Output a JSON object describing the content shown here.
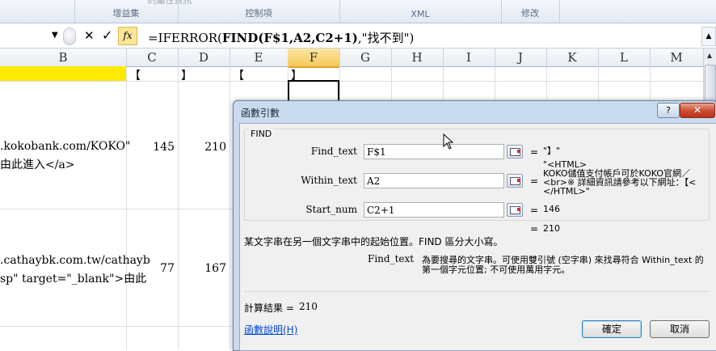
{
  "ribbon": {
    "groups": [
      "增益集",
      "控制項",
      "XML",
      "修改"
    ],
    "faded_top": "的屬性資訊"
  },
  "formula_bar": {
    "cancel_symbol": "✕",
    "enter_symbol": "✓",
    "fx_label": "fx",
    "formula_pre": "=IFERROR(",
    "formula_fn": "FIND(F$1,A2,C2+1)",
    "formula_post": ",\"找不到\")"
  },
  "columns": [
    "B",
    "C",
    "D",
    "E",
    "F",
    "G",
    "H",
    "I",
    "J",
    "K",
    "L",
    "M"
  ],
  "selected_column": "F",
  "grid": {
    "row1": {
      "C": "【",
      "D": "】",
      "E": "【",
      "F": "】"
    },
    "row2": {
      "B_line1": ".kokobank.com/KOKO\"",
      "B_line2": "由此進入</a>",
      "C": "145",
      "D": "210"
    },
    "row3": {
      "B_line1": ".cathaybk.com.tw/cathayb",
      "B_line2": "sp\" target=\"_blank\">由此",
      "C": "77",
      "D": "167"
    }
  },
  "dialog": {
    "title": "函數引數",
    "help_symbol": "?",
    "close_symbol": "✕",
    "function_name": "FIND",
    "args": [
      {
        "label": "Find_text",
        "value": "F$1",
        "result": "\"】\""
      },
      {
        "label": "Within_text",
        "value": "A2",
        "result": "\"<HTML>\nKOKO儲值支付帳戶可於KOKO官網／\n<br>※ 詳細資訊請參考以下網址：【<\n</HTML>\""
      },
      {
        "label": "Start_num",
        "value": "C2+1",
        "result": "146"
      }
    ],
    "overall_result": "210",
    "description": "某文字串在另一個文字串中的起始位置。FIND 區分大小寫。",
    "arg_help_label": "Find_text",
    "arg_help_text_line1": "為要搜尋的文字串。可使用雙引號 (空字串) 來找尋符合 Within_text 的",
    "arg_help_text_line2": "第一個字元位置; 不可使用萬用字元。",
    "calc_result_label": "計算結果 =",
    "calc_result_value": "210",
    "help_link": "函數說明(H)",
    "ok_label": "確定",
    "cancel_label": "取消"
  },
  "colors": {
    "selected_column_header": "#f7c85a",
    "row1_highlight": "#ffeb00",
    "fx_button": "#fbe59a",
    "dialog_frame": "#c8dbef",
    "close_button": "#c94a2e"
  }
}
